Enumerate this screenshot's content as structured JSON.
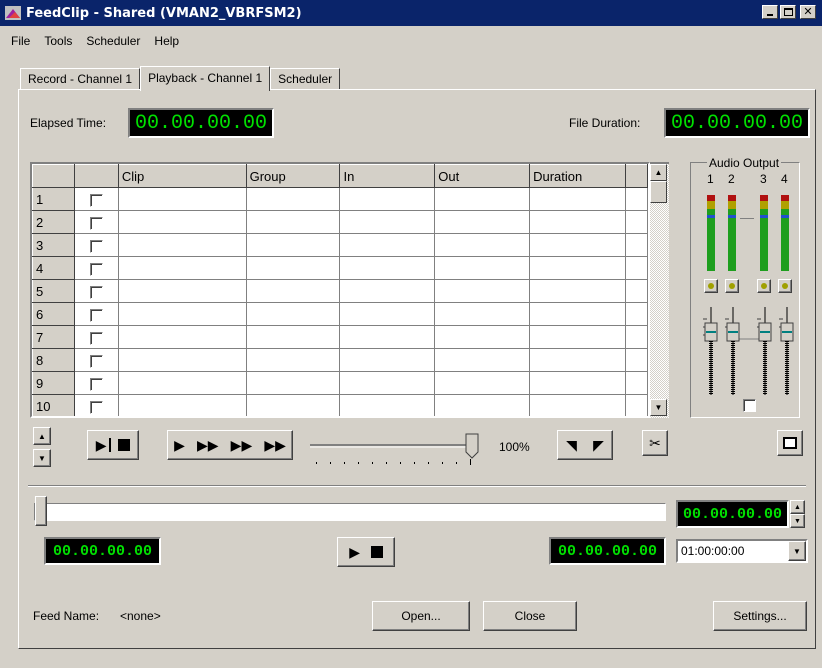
{
  "window": {
    "title": "FeedClip -  Shared (VMAN2_VBRFSM2)"
  },
  "menu": [
    "File",
    "Tools",
    "Scheduler",
    "Help"
  ],
  "tabs": [
    "Record - Channel 1",
    "Playback - Channel 1",
    "Scheduler"
  ],
  "active_tab": "Playback - Channel 1",
  "elapsed": {
    "label": "Elapsed Time:",
    "value": "00.00.00.00"
  },
  "duration": {
    "label": "File Duration:",
    "value": "00.00.00.00"
  },
  "grid": {
    "columns": [
      "Clip",
      "Group",
      "In",
      "Out",
      "Duration"
    ],
    "rows": [
      "1",
      "2",
      "3",
      "4",
      "5",
      "6",
      "7",
      "8",
      "9",
      "10"
    ]
  },
  "audio": {
    "title": "Audio Output",
    "channels": [
      "1",
      "2",
      "3",
      "4"
    ]
  },
  "speed": {
    "percent_label": "100%",
    "value": 100
  },
  "timecodes": {
    "right_top": "00.00.00.00",
    "left": "00.00.00.00",
    "right": "00.00.00.00"
  },
  "duration_select": {
    "value": "01:00:00:00"
  },
  "feed": {
    "label": "Feed Name:",
    "value": "<none>"
  },
  "buttons": {
    "open": "Open...",
    "close": "Close",
    "settings": "Settings..."
  },
  "colors": {
    "titlebar": "#0a246a",
    "lcd_text": "#00e000",
    "lcd_bg": "#000000",
    "face": "#d4d0c8"
  }
}
